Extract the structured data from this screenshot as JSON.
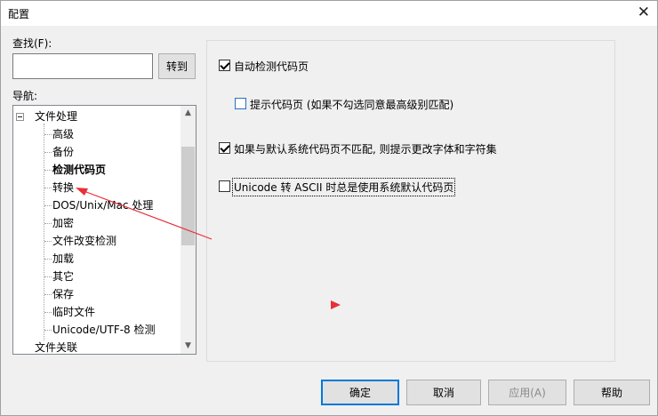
{
  "window": {
    "title": "配置",
    "close_glyph": "✕"
  },
  "search": {
    "label": "查找(F):",
    "value": "",
    "goto_label": "转到"
  },
  "nav": {
    "label": "导航:",
    "root": "文件处理",
    "items": [
      "高级",
      "备份",
      "检测代码页",
      "转换",
      "DOS/Unix/Mac 处理",
      "加密",
      "文件改变检测",
      "加载",
      "其它",
      "保存",
      "临时文件",
      "Unicode/UTF-8 检测"
    ],
    "selected": "检测代码页",
    "next_root": "文件关联"
  },
  "options": {
    "auto_detect": {
      "label": "自动检测代码页",
      "checked": true
    },
    "prompt_codepage": {
      "label": "提示代码页 (如果不勾选同意最高级别匹配)",
      "checked": false
    },
    "mismatch_prompt": {
      "label": "如果与默认系统代码页不匹配, 则提示更改字体和字符集",
      "checked": true
    },
    "unicode_ascii": {
      "label": "Unicode 转 ASCII 时总是使用系统默认代码页",
      "checked": false
    }
  },
  "buttons": {
    "ok": "确定",
    "cancel": "取消",
    "apply": "应用(A)",
    "help": "帮助"
  },
  "colors": {
    "arrow": "#e8303a",
    "focus": "#0078d7"
  },
  "icons": {
    "close": "close-icon",
    "expander": "collapse-icon",
    "scroll_up": "scroll-up-icon",
    "scroll_down": "scroll-down-icon"
  }
}
